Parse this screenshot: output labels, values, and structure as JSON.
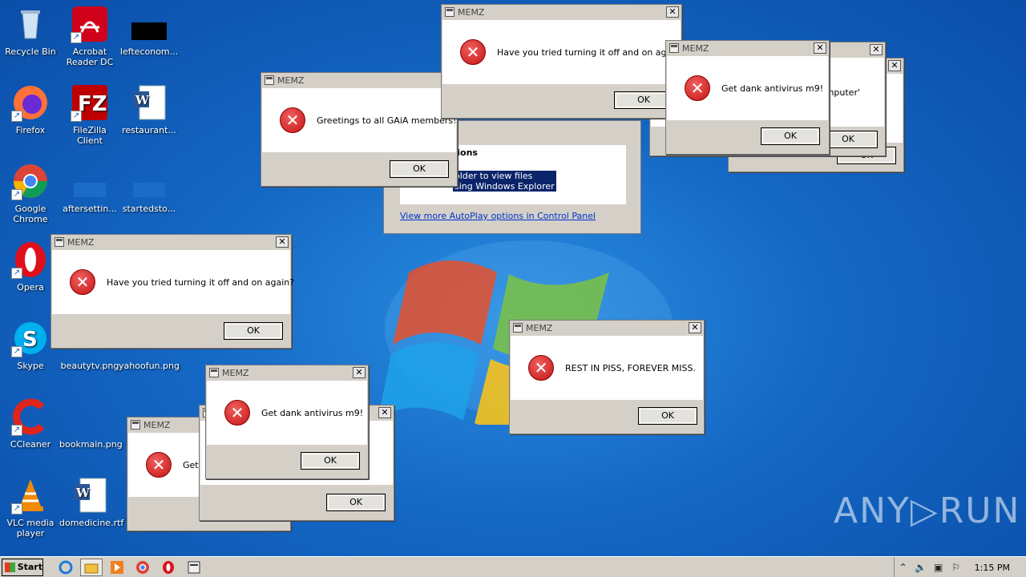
{
  "desktop": {
    "icons": [
      {
        "label": "Recycle Bin"
      },
      {
        "label": "Acrobat Reader DC"
      },
      {
        "label": "lefteconom..."
      },
      {
        "label": "Firefox"
      },
      {
        "label": "FileZilla Client"
      },
      {
        "label": "restaurant..."
      },
      {
        "label": "Google Chrome"
      },
      {
        "label": "aftersettin..."
      },
      {
        "label": "startedsto..."
      },
      {
        "label": "Opera"
      },
      {
        "label": "Skype"
      },
      {
        "label": "beautytv.png"
      },
      {
        "label": "yahoofun.png"
      },
      {
        "label": "CCleaner"
      },
      {
        "label": "bookmain.png"
      },
      {
        "label": "VLC media player"
      },
      {
        "label": "domedicine.rtf"
      }
    ]
  },
  "dialogs": {
    "title": "MEMZ",
    "ok_label": "OK",
    "close_glyph": "✕",
    "messages": {
      "turn_off": "Have you tried turning it off and on again?",
      "greetings": "Greetings to all GAiA members!",
      "antivirus": "Get dank antivirus m9!",
      "rest": "REST IN PISS, FOREVER MISS.",
      "antivirus_partial": "Get d",
      "computer_partial": "omputer'"
    }
  },
  "autoplay": {
    "heading": "tions",
    "option_line1": "older to view files",
    "option_line2": "sing Windows Explorer",
    "link": "View more AutoPlay options in Control Panel"
  },
  "taskbar": {
    "start_label": "Start",
    "clock": "1:15 PM"
  },
  "watermark": "ANY▷RUN",
  "colors": {
    "desktop_blue": "#1467c4",
    "dialog_gray": "#d4d0c8",
    "error_red": "#c41414"
  }
}
